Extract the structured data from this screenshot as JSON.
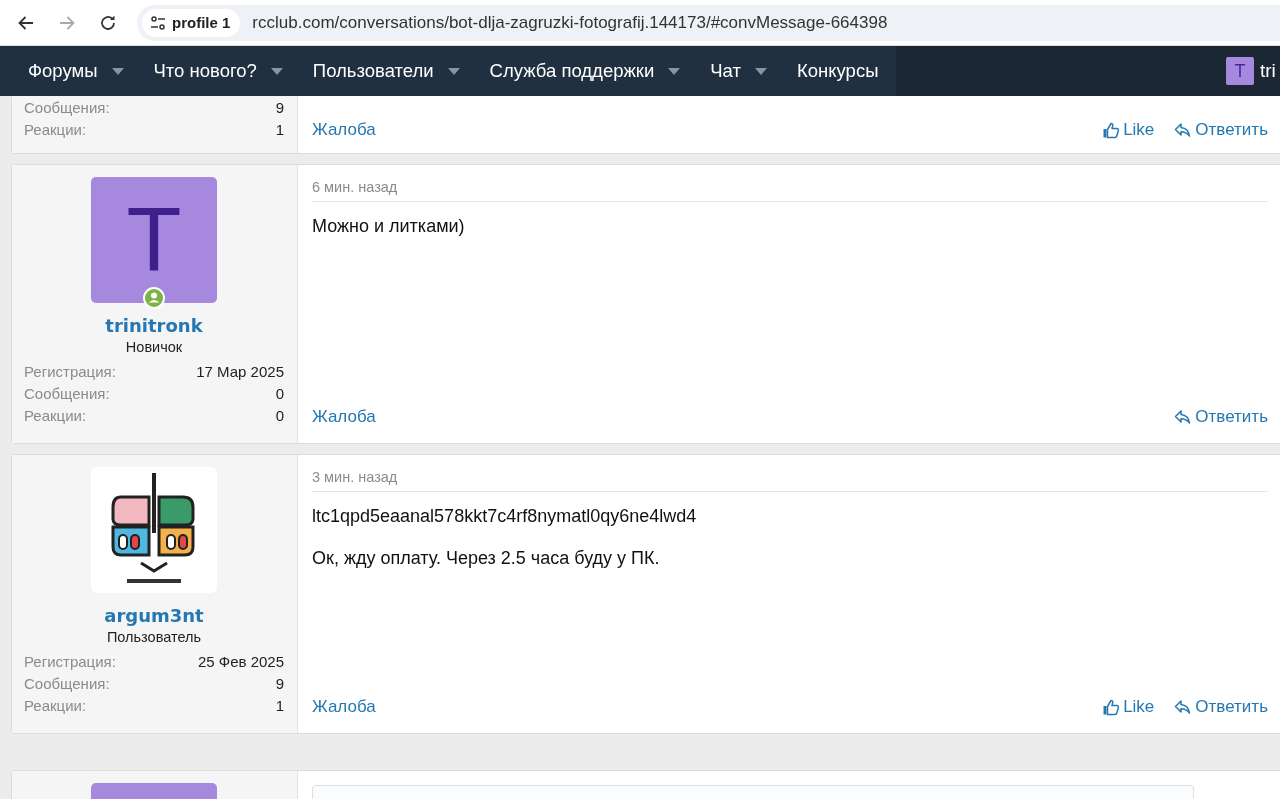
{
  "browser": {
    "back_enabled": true,
    "forward_enabled": false,
    "profile_chip": "profile 1",
    "url": "rcclub.com/conversations/bot-dlja-zagruzki-fotografij.144173/#convMessage-664398"
  },
  "nav": {
    "items": [
      {
        "label": "Форумы",
        "has_menu": true
      },
      {
        "label": "Что нового?",
        "has_menu": true
      },
      {
        "label": "Пользователи",
        "has_menu": true
      },
      {
        "label": "Служба поддержки",
        "has_menu": true
      },
      {
        "label": "Чат",
        "has_menu": true
      },
      {
        "label": "Конкурсы",
        "has_menu": false
      }
    ],
    "user": {
      "initial": "T",
      "name": "tri"
    }
  },
  "messages": [
    {
      "kind": "cut_top",
      "stats": [
        {
          "label": "Сообщения:",
          "value": "9"
        },
        {
          "label": "Реакции:",
          "value": "1"
        }
      ],
      "report": "Жалоба",
      "like": "Like",
      "reply": "Ответить"
    },
    {
      "kind": "full",
      "avatar": {
        "kind": "letter",
        "initial": "T"
      },
      "online": true,
      "username": "trinitronk",
      "role": "Новичок",
      "stats": [
        {
          "label": "Регистрация:",
          "value": "17 Мар 2025"
        },
        {
          "label": "Сообщения:",
          "value": "0"
        },
        {
          "label": "Реакции:",
          "value": "0"
        }
      ],
      "time": "6 мин. назад",
      "paragraphs": [
        "Можно и литками)"
      ],
      "report": "Жалоба",
      "reply": "Ответить"
    },
    {
      "kind": "full",
      "avatar": {
        "kind": "picture"
      },
      "online": false,
      "username": "argum3nt",
      "role": "Пользователь",
      "stats": [
        {
          "label": "Регистрация:",
          "value": "25 Фев 2025"
        },
        {
          "label": "Сообщения:",
          "value": "9"
        },
        {
          "label": "Реакции:",
          "value": "1"
        }
      ],
      "time": "3 мин. назад",
      "paragraphs": [
        "ltc1qpd5eaanal578kkt7c4rf8nymatl0qy6ne4lwd4",
        "Ок, жду оплату. Через 2.5 часа буду у ПК."
      ],
      "report": "Жалоба",
      "like": "Like",
      "reply": "Ответить"
    },
    {
      "kind": "cut_bottom"
    }
  ]
}
